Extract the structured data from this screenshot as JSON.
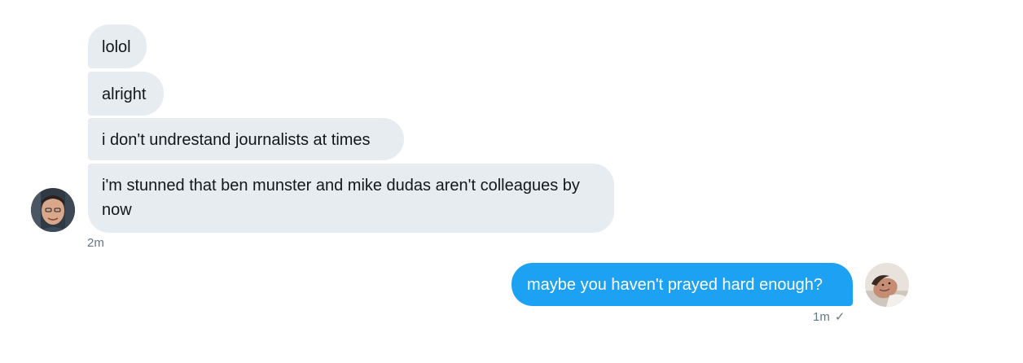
{
  "conversation": {
    "received": [
      {
        "text": "lolol"
      },
      {
        "text": "alright"
      },
      {
        "text": "i don't undrestand journalists at times"
      },
      {
        "text": "i'm stunned that ben munster and mike dudas aren't colleagues by now"
      }
    ],
    "received_timestamp": "2m",
    "sent": [
      {
        "text": "maybe you haven't prayed hard enough?"
      }
    ],
    "sent_timestamp": "1m",
    "sent_status_icon": "checkmark-icon",
    "sent_status_glyph": "✓"
  },
  "colors": {
    "received_bubble": "#e6ecf0",
    "sent_bubble": "#1da1f2",
    "timestamp": "#657786"
  }
}
